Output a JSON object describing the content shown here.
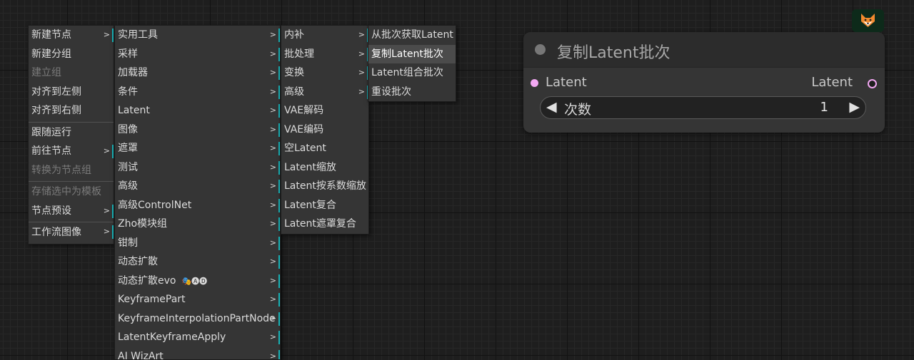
{
  "menu_level1": [
    {
      "label": "新建节点",
      "submenu": true
    },
    {
      "label": "新建分组"
    },
    {
      "label": "建立组",
      "disabled": true
    },
    {
      "label": "对齐到左侧"
    },
    {
      "label": "对齐到右侧"
    },
    {
      "label": "跟随运行",
      "separator": true
    },
    {
      "label": "前往节点",
      "submenu": true
    },
    {
      "label": "转换为节点组",
      "disabled": true
    },
    {
      "label": "存储选中为模板",
      "disabled": true,
      "separator": true
    },
    {
      "label": "节点预设",
      "submenu": true
    },
    {
      "label": "工作流图像",
      "submenu": true,
      "separator": true
    }
  ],
  "menu_level2": [
    {
      "label": "实用工具"
    },
    {
      "label": "采样"
    },
    {
      "label": "加载器"
    },
    {
      "label": "条件"
    },
    {
      "label": "Latent"
    },
    {
      "label": "图像"
    },
    {
      "label": "遮罩"
    },
    {
      "label": "测试"
    },
    {
      "label": "高级"
    },
    {
      "label": "高级ControlNet"
    },
    {
      "label": "Zho模块组"
    },
    {
      "label": "钳制"
    },
    {
      "label": "动态扩散"
    },
    {
      "label": "动态扩散evo",
      "badge": "🎭🅐🅓"
    },
    {
      "label": "KeyframePart"
    },
    {
      "label": "KeyframeInterpolationPartNode"
    },
    {
      "label": "LatentKeyframeApply"
    },
    {
      "label": "AI WizArt"
    }
  ],
  "menu_level3": [
    {
      "label": "内补",
      "submenu": true
    },
    {
      "label": "批处理",
      "submenu": true
    },
    {
      "label": "变换",
      "submenu": true
    },
    {
      "label": "高级",
      "submenu": true
    },
    {
      "label": "VAE解码"
    },
    {
      "label": "VAE编码"
    },
    {
      "label": "空Latent"
    },
    {
      "label": "Latent缩放"
    },
    {
      "label": "Latent按系数缩放"
    },
    {
      "label": "Latent复合"
    },
    {
      "label": "Latent遮罩复合"
    }
  ],
  "menu_level4": [
    {
      "label": "从批次获取Latent"
    },
    {
      "label": "复制Latent批次",
      "highlight": true
    },
    {
      "label": "Latent组合批次"
    },
    {
      "label": "重设批次"
    }
  ],
  "node": {
    "title": "复制Latent批次",
    "input_label": "Latent",
    "output_label": "Latent",
    "widget_label": "次数",
    "widget_value": "1"
  },
  "colors": {
    "accent": "#19b4b8",
    "slot_latent": "#f2a8f2",
    "menu_bg": "#353535",
    "canvas_bg": "#1e1e1e"
  },
  "icons": {
    "submenu_arrow": "chevron-right-icon",
    "widget_left": "triangle-left-icon",
    "widget_right": "triangle-right-icon",
    "top_right": "fox-icon"
  }
}
